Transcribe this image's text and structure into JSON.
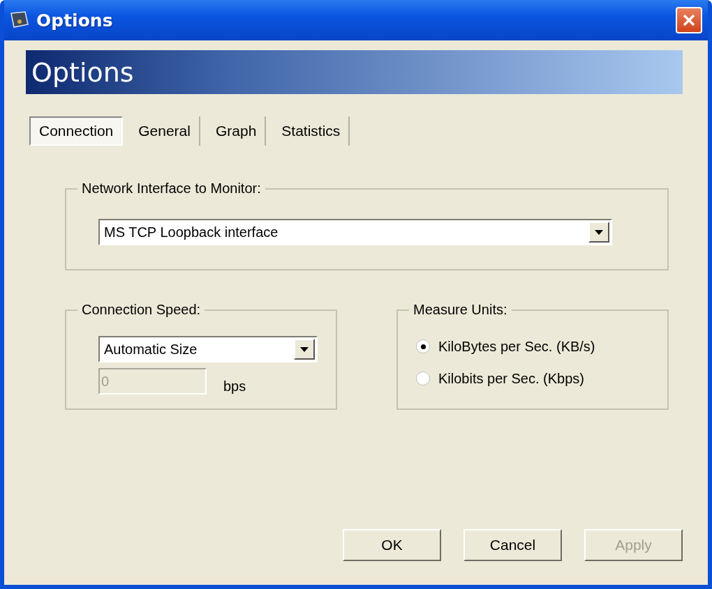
{
  "window": {
    "title": "Options"
  },
  "banner": {
    "title": "Options"
  },
  "tabs": [
    {
      "label": "Connection",
      "selected": true
    },
    {
      "label": "General",
      "selected": false
    },
    {
      "label": "Graph",
      "selected": false
    },
    {
      "label": "Statistics",
      "selected": false
    }
  ],
  "network_interface": {
    "label": "Network Interface to Monitor:",
    "value": "MS TCP Loopback interface"
  },
  "connection_speed": {
    "label": "Connection Speed:",
    "value": "Automatic Size",
    "speed_field": {
      "value": "0",
      "disabled": true
    },
    "unit": "bps"
  },
  "measure_units": {
    "label": "Measure Units:",
    "options": [
      {
        "label": "KiloBytes per Sec. (KB/s)",
        "selected": true
      },
      {
        "label": "Kilobits per Sec. (Kbps)",
        "selected": false
      }
    ]
  },
  "buttons": [
    {
      "label": "OK",
      "disabled": false
    },
    {
      "label": "Cancel",
      "disabled": false
    },
    {
      "label": "Apply",
      "disabled": true
    }
  ]
}
